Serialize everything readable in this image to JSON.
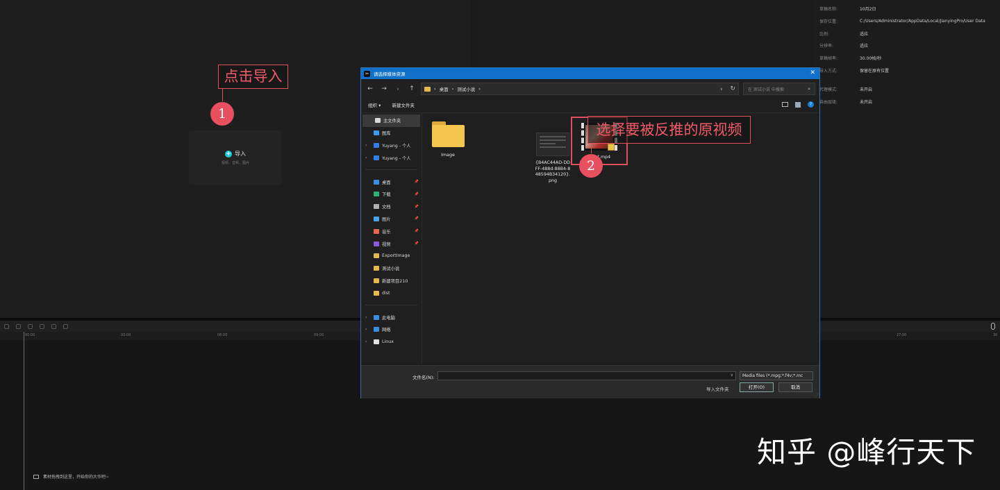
{
  "media_panel": {
    "import_label": "导入",
    "import_hint": "视频、音频、图片"
  },
  "properties": [
    {
      "label": "草稿名称:",
      "value": "10月2日"
    },
    {
      "label": "保存位置:",
      "value": "C:/Users/Administrator/AppData/Local/JianyingPro/User Data"
    },
    {
      "label": "比例:",
      "value": "适应"
    },
    {
      "label": "分辨率:",
      "value": "适应"
    },
    {
      "label": "草稿帧率:",
      "value": "30.00帧/秒"
    },
    {
      "label": "导入方式:",
      "value": "保留在原有位置"
    },
    {
      "label": "代理模式:",
      "value": "未开启"
    },
    {
      "label": "自由层级:",
      "value": "未开启"
    }
  ],
  "timeline": {
    "ticks": [
      "00:00",
      "03:00",
      "06:00",
      "09:00",
      "27:00",
      "30"
    ],
    "drag_hint": "素材拖拽到这里，开始你的大作吧~"
  },
  "annotations": {
    "step1_text": "点击导入",
    "step1_number": "1",
    "step2_text": "选择要被反推的原视频",
    "step2_number": "2"
  },
  "dialog": {
    "title": "请选择媒体资源",
    "close": "✕",
    "breadcrumb": [
      "桌面",
      "测试小说"
    ],
    "search_placeholder": "在 测试小说 中搜索",
    "organize": "组织 ▾",
    "new_folder": "新建文件夹",
    "sidebar": [
      {
        "label": "主文件夹",
        "icon": "home-icon",
        "color": "#d9d9d9",
        "pinned": false,
        "expand": false,
        "selected": true
      },
      {
        "label": "图库",
        "icon": "gallery-icon",
        "color": "#3d9be9",
        "pinned": false,
        "expand": false,
        "selected": false
      },
      {
        "label": "Yuyang - 个人",
        "icon": "onedrive-icon",
        "color": "#2f7fe0",
        "pinned": false,
        "expand": true,
        "selected": false
      },
      {
        "label": "Yuyang - 个人",
        "icon": "onedrive-icon",
        "color": "#2f7fe0",
        "pinned": false,
        "expand": true,
        "selected": false
      },
      {
        "sep": true
      },
      {
        "label": "桌面",
        "icon": "desktop-icon",
        "color": "#3a8ee0",
        "pinned": true,
        "expand": false,
        "selected": false
      },
      {
        "label": "下载",
        "icon": "download-icon",
        "color": "#2db37a",
        "pinned": true,
        "expand": false,
        "selected": false
      },
      {
        "label": "文档",
        "icon": "document-icon",
        "color": "#b0b0b0",
        "pinned": true,
        "expand": false,
        "selected": false
      },
      {
        "label": "图片",
        "icon": "pictures-icon",
        "color": "#4aa3e8",
        "pinned": true,
        "expand": false,
        "selected": false
      },
      {
        "label": "音乐",
        "icon": "music-icon",
        "color": "#e06a4a",
        "pinned": true,
        "expand": false,
        "selected": false
      },
      {
        "label": "视频",
        "icon": "video-icon",
        "color": "#8a5cd6",
        "pinned": true,
        "expand": false,
        "selected": false
      },
      {
        "label": "ExportImage",
        "icon": "folder-icon",
        "color": "#e6b84e",
        "pinned": false,
        "expand": false,
        "selected": false
      },
      {
        "label": "测试小说",
        "icon": "folder-icon",
        "color": "#e6b84e",
        "pinned": false,
        "expand": false,
        "selected": false
      },
      {
        "label": "新建项目210",
        "icon": "folder-icon",
        "color": "#e6b84e",
        "pinned": false,
        "expand": false,
        "selected": false
      },
      {
        "label": "dist",
        "icon": "folder-icon",
        "color": "#e6b84e",
        "pinned": false,
        "expand": false,
        "selected": false
      },
      {
        "sep": true
      },
      {
        "label": "此电脑",
        "icon": "computer-icon",
        "color": "#3a8ee0",
        "pinned": false,
        "expand": true,
        "selected": false
      },
      {
        "label": "网络",
        "icon": "network-icon",
        "color": "#3a8ee0",
        "pinned": false,
        "expand": true,
        "selected": false
      },
      {
        "label": "Linux",
        "icon": "linux-icon",
        "color": "#e0e0e0",
        "pinned": false,
        "expand": true,
        "selected": false
      }
    ],
    "files": {
      "folder_name": "Image",
      "png_name_1": "{B4AC44AD-DD",
      "png_name_2": "FF-488d-88B4-8",
      "png_name_3": "48594B34120}.",
      "png_name_4": "png",
      "video_name": "input.mp4"
    },
    "filename_label": "文件名(N):",
    "filename_value": "",
    "filter": "Media files (*.mpg;*.f4v;*.mc",
    "import_folder": "导入文件夹",
    "open": "打开(O)",
    "cancel": "取消"
  },
  "watermark": "知乎 @峰行天下"
}
